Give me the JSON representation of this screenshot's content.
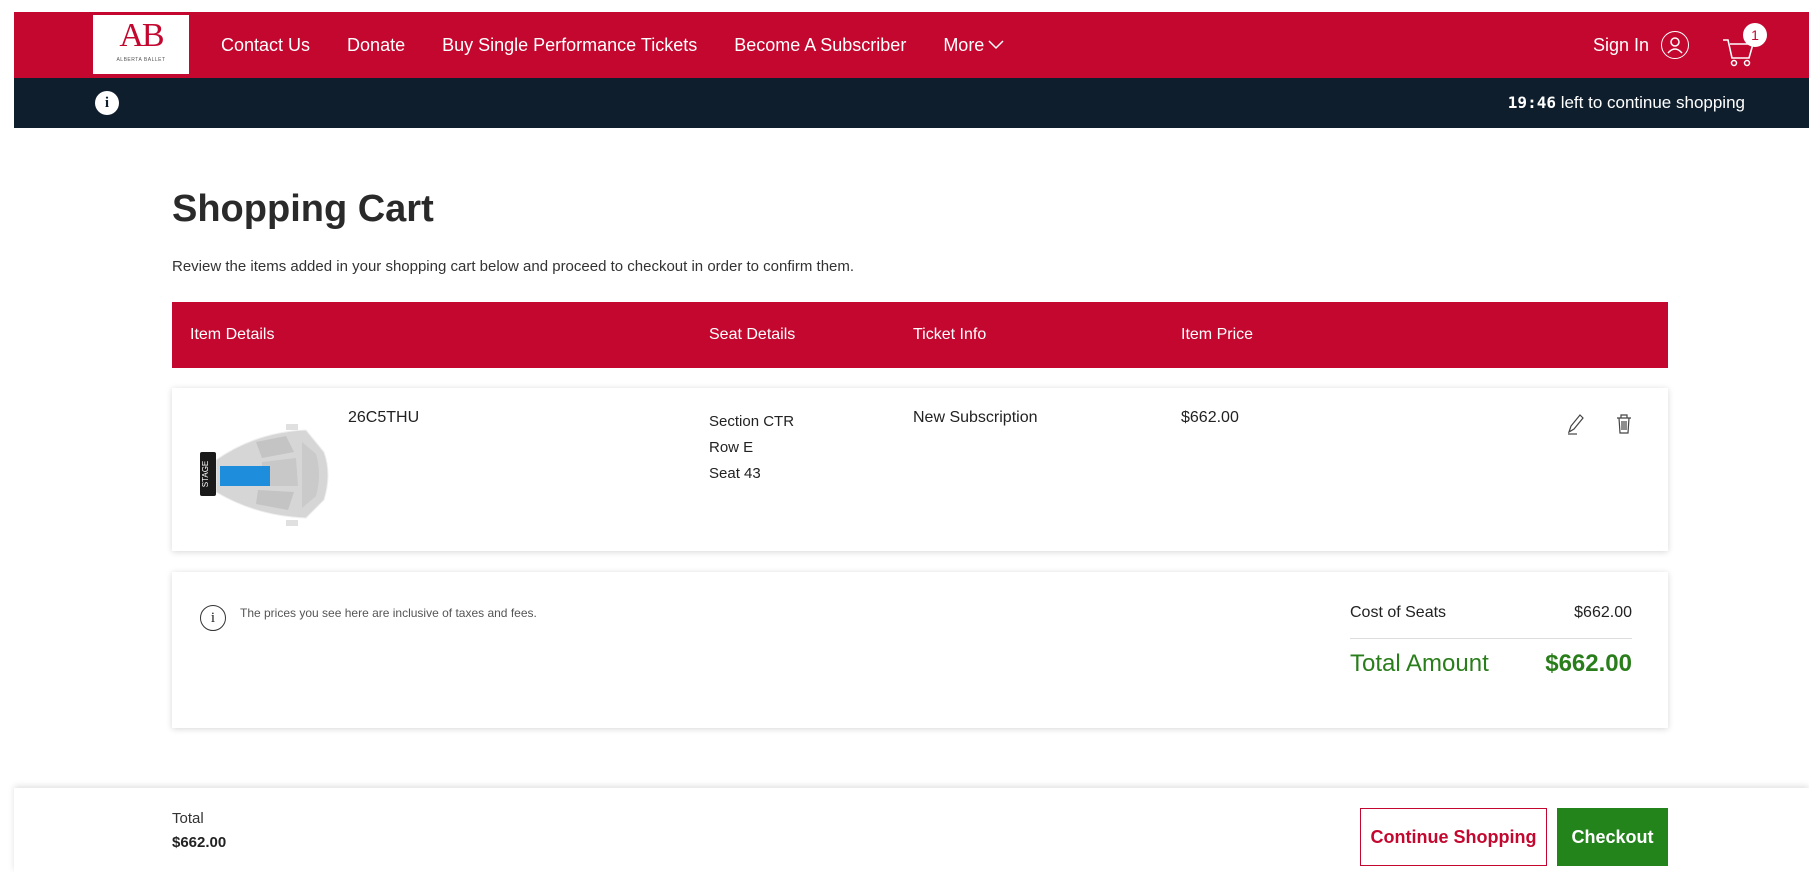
{
  "brand": {
    "logo_mono": "AB",
    "logo_sub": "ALBERTA BALLET"
  },
  "nav": {
    "items": [
      "Contact Us",
      "Donate",
      "Buy Single Performance Tickets",
      "Become A Subscriber",
      "More"
    ],
    "sign_in": "Sign In",
    "cart_count": "1"
  },
  "timer": {
    "time": "19:46",
    "text": " left to continue shopping"
  },
  "page": {
    "title": "Shopping Cart",
    "intro": "Review the items added in your shopping cart below and proceed to checkout in order to confirm them."
  },
  "table": {
    "headers": [
      "Item Details",
      "Seat Details",
      "Ticket Info",
      "Item Price"
    ]
  },
  "item": {
    "stage_label": "STAGE",
    "code": "26C5THU",
    "section": "Section CTR",
    "row": "Row E",
    "seat": "Seat 43",
    "ticket_info": "New Subscription",
    "price": "$662.00"
  },
  "summary": {
    "note": "The prices you see here are inclusive of taxes and fees.",
    "cost_label": "Cost of Seats",
    "cost_value": "$662.00",
    "total_label": "Total Amount",
    "total_value": "$662.00"
  },
  "footer": {
    "total_label": "Total",
    "total_value": "$662.00",
    "continue_label": "Continue Shopping",
    "checkout_label": "Checkout"
  },
  "colors": {
    "brand": "#c3072f",
    "dark": "#0e1e2d",
    "green": "#23841b"
  }
}
